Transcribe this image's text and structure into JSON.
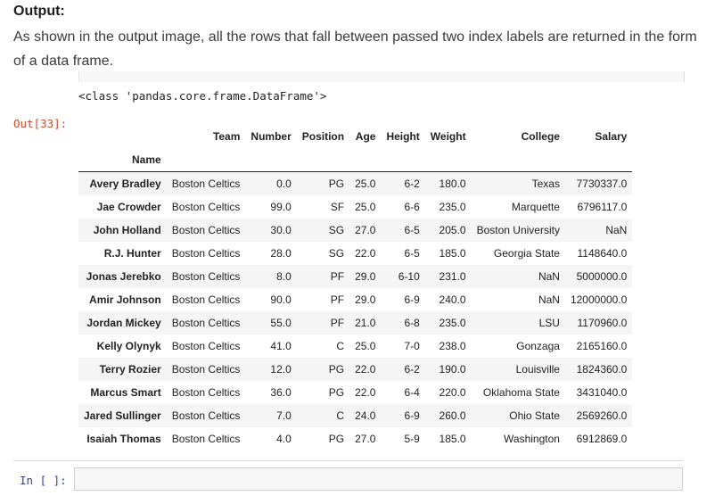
{
  "article": {
    "heading": "Output:",
    "description": "As shown in the output image, all the rows that fall between passed two index labels are returned in the form of a data frame."
  },
  "notebook": {
    "stdout_text": "<class 'pandas.core.frame.DataFrame'>",
    "out_prompt": "Out[33]:",
    "in_prompt": "In [ ]:",
    "input_value": ""
  },
  "dataframe": {
    "index_name": "Name",
    "columns": [
      "Team",
      "Number",
      "Position",
      "Age",
      "Height",
      "Weight",
      "College",
      "Salary"
    ],
    "rows": [
      {
        "name": "Avery Bradley",
        "cells": [
          "Boston Celtics",
          "0.0",
          "PG",
          "25.0",
          "6-2",
          "180.0",
          "Texas",
          "7730337.0"
        ]
      },
      {
        "name": "Jae Crowder",
        "cells": [
          "Boston Celtics",
          "99.0",
          "SF",
          "25.0",
          "6-6",
          "235.0",
          "Marquette",
          "6796117.0"
        ]
      },
      {
        "name": "John Holland",
        "cells": [
          "Boston Celtics",
          "30.0",
          "SG",
          "27.0",
          "6-5",
          "205.0",
          "Boston University",
          "NaN"
        ]
      },
      {
        "name": "R.J. Hunter",
        "cells": [
          "Boston Celtics",
          "28.0",
          "SG",
          "22.0",
          "6-5",
          "185.0",
          "Georgia State",
          "1148640.0"
        ]
      },
      {
        "name": "Jonas Jerebko",
        "cells": [
          "Boston Celtics",
          "8.0",
          "PF",
          "29.0",
          "6-10",
          "231.0",
          "NaN",
          "5000000.0"
        ]
      },
      {
        "name": "Amir Johnson",
        "cells": [
          "Boston Celtics",
          "90.0",
          "PF",
          "29.0",
          "6-9",
          "240.0",
          "NaN",
          "12000000.0"
        ]
      },
      {
        "name": "Jordan Mickey",
        "cells": [
          "Boston Celtics",
          "55.0",
          "PF",
          "21.0",
          "6-8",
          "235.0",
          "LSU",
          "1170960.0"
        ]
      },
      {
        "name": "Kelly Olynyk",
        "cells": [
          "Boston Celtics",
          "41.0",
          "C",
          "25.0",
          "7-0",
          "238.0",
          "Gonzaga",
          "2165160.0"
        ]
      },
      {
        "name": "Terry Rozier",
        "cells": [
          "Boston Celtics",
          "12.0",
          "PG",
          "22.0",
          "6-2",
          "190.0",
          "Louisville",
          "1824360.0"
        ]
      },
      {
        "name": "Marcus Smart",
        "cells": [
          "Boston Celtics",
          "36.0",
          "PG",
          "22.0",
          "6-4",
          "220.0",
          "Oklahoma State",
          "3431040.0"
        ]
      },
      {
        "name": "Jared Sullinger",
        "cells": [
          "Boston Celtics",
          "7.0",
          "C",
          "24.0",
          "6-9",
          "260.0",
          "Ohio State",
          "2569260.0"
        ]
      },
      {
        "name": "Isaiah Thomas",
        "cells": [
          "Boston Celtics",
          "4.0",
          "PG",
          "27.0",
          "5-9",
          "185.0",
          "Washington",
          "6912869.0"
        ]
      }
    ]
  }
}
